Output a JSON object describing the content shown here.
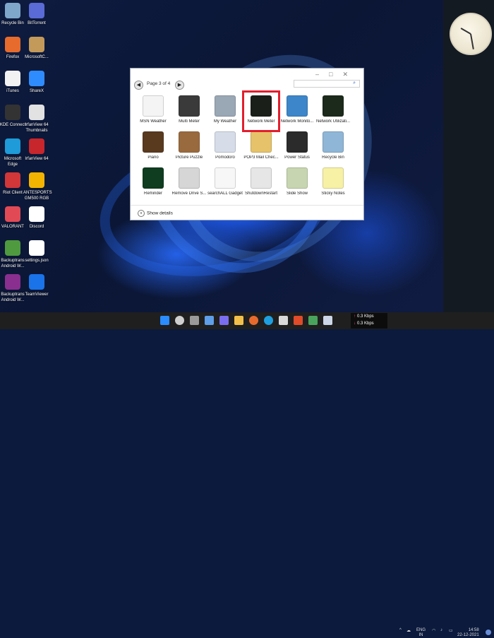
{
  "desktop_icons": [
    {
      "label": "Recycle Bin",
      "icon": "recycle-bin-icon",
      "color": "#7fa7c9"
    },
    {
      "label": "BitTorrent",
      "icon": "bittorrent-icon",
      "color": "#5a6ad6"
    },
    {
      "label": "Firefox",
      "icon": "firefox-icon",
      "color": "#e76b2c"
    },
    {
      "label": "MicrosoftC...",
      "icon": "package-icon",
      "color": "#c49a5a"
    },
    {
      "label": "iTunes",
      "icon": "itunes-icon",
      "color": "#f2f2f2"
    },
    {
      "label": "ShareX",
      "icon": "sharex-icon",
      "color": "#2f8cff"
    },
    {
      "label": "KDE Connect",
      "icon": "kde-connect-icon",
      "color": "#333333"
    },
    {
      "label": "IrfanView 64 Thumbnails",
      "icon": "irfanview-icon",
      "color": "#e2e2e2"
    },
    {
      "label": "Microsoft Edge",
      "icon": "edge-icon",
      "color": "#1e9bd8"
    },
    {
      "label": "IrfanView 64",
      "icon": "irfanview-red-icon",
      "color": "#c7262c"
    },
    {
      "label": "Riot Client",
      "icon": "riot-icon",
      "color": "#d13639"
    },
    {
      "label": "ANTESPORTS GM500 RGB",
      "icon": "antesports-icon",
      "color": "#f2b400"
    },
    {
      "label": "VALORANT",
      "icon": "valorant-icon",
      "color": "#e14a55"
    },
    {
      "label": "Discord",
      "icon": "document-icon",
      "color": "#ffffff"
    },
    {
      "label": "Backuptrans Android W...",
      "icon": "backuptrans-icon",
      "color": "#4f9a3f"
    },
    {
      "label": "settings.json",
      "icon": "document-icon",
      "color": "#ffffff"
    },
    {
      "label": "Backuptrans Android W...",
      "icon": "winrar-icon",
      "color": "#8a2f8f"
    },
    {
      "label": "TeamViewer",
      "icon": "teamviewer-icon",
      "color": "#1a73e8"
    }
  ],
  "window": {
    "page_label": "Page 3 of 4",
    "search_placeholder": "",
    "show_details": "Show details",
    "gadgets": [
      {
        "label": "MSN Weather",
        "icon": "msn-icon",
        "color": "#f4f4f4"
      },
      {
        "label": "Multi Meter",
        "icon": "meter-icon",
        "color": "#3a3a3a"
      },
      {
        "label": "My Weather",
        "icon": "weather-icon",
        "color": "#9aa7b5"
      },
      {
        "label": "Network Meter",
        "icon": "network-meter-icon",
        "color": "#1a1f1a"
      },
      {
        "label": "Network Monito...",
        "icon": "globe-icon",
        "color": "#3d86c9"
      },
      {
        "label": "Network Utilizati...",
        "icon": "terminal-icon",
        "color": "#1b2a1b"
      },
      {
        "label": "Piano",
        "icon": "piano-icon",
        "color": "#5a3a1f"
      },
      {
        "label": "Picture Puzzle",
        "icon": "puzzle-icon",
        "color": "#9a6a3f"
      },
      {
        "label": "Pomodoro",
        "icon": "pomodoro-icon",
        "color": "#d6dde8"
      },
      {
        "label": "POP3 Mail Chec...",
        "icon": "mail-icon",
        "color": "#e6c36a"
      },
      {
        "label": "Power Status",
        "icon": "battery-icon",
        "color": "#2b2b2b"
      },
      {
        "label": "Recycle Bin",
        "icon": "recycle-bin-icon",
        "color": "#8fb6d6"
      },
      {
        "label": "Reminder",
        "icon": "reminder-icon",
        "color": "#0f3d1f"
      },
      {
        "label": "Remove Drive S...",
        "icon": "usb-icon",
        "color": "#d6d6d6"
      },
      {
        "label": "searchALL Gadget",
        "icon": "google-icon",
        "color": "#f7f7f7"
      },
      {
        "label": "ShutdownRestart",
        "icon": "power-icon",
        "color": "#e6e6e6"
      },
      {
        "label": "Slide Show",
        "icon": "slideshow-icon",
        "color": "#c7d6b0"
      },
      {
        "label": "Sticky Notes",
        "icon": "note-icon",
        "color": "#f7f1a6"
      }
    ]
  },
  "taskbar": {
    "net_up": "0.3 Kbps",
    "net_down": "0.3 Kbps",
    "lang": "ENG",
    "region": "IN",
    "time": "14:58",
    "date": "22-12-2021"
  }
}
